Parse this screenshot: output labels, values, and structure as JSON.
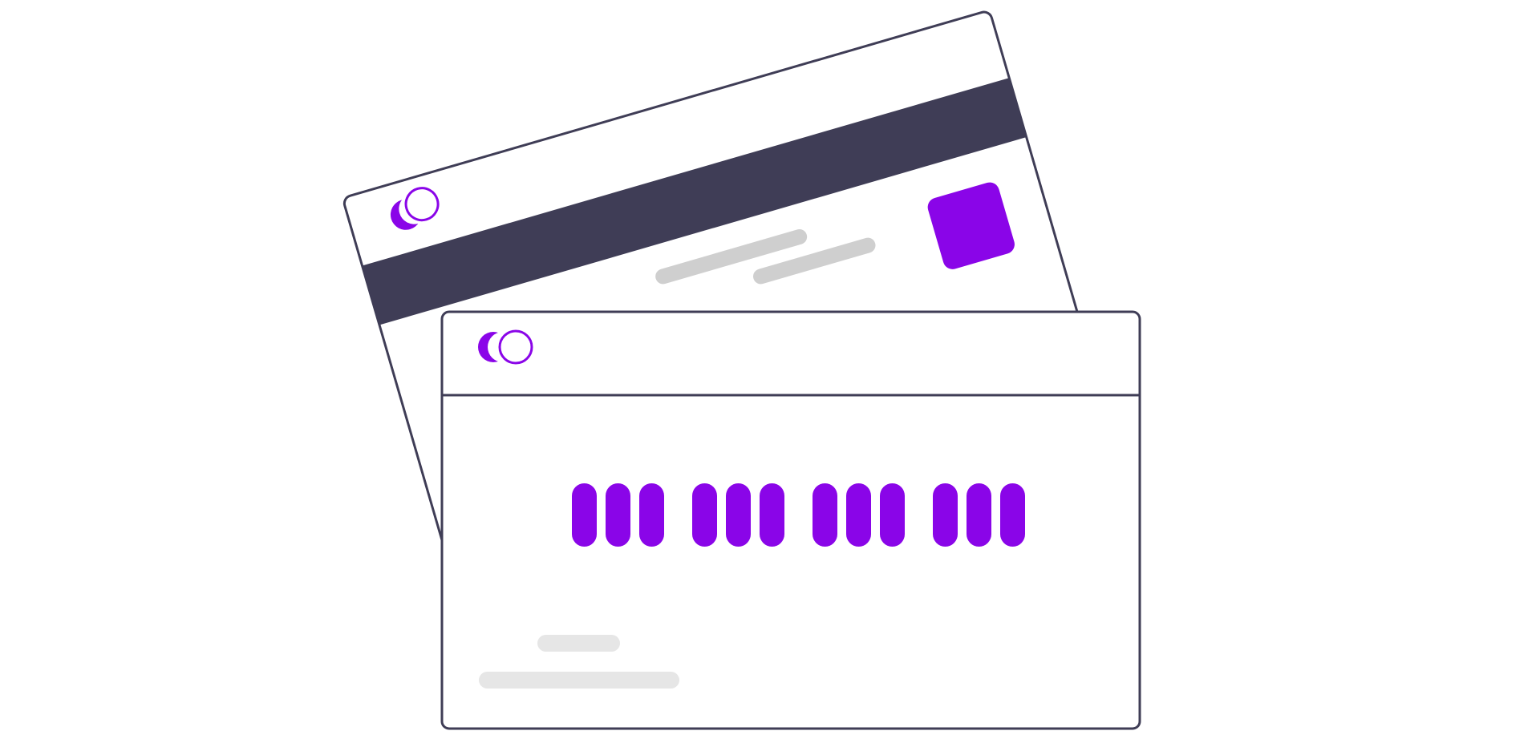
{
  "illustration": {
    "subject": "credit-card-front-and-back",
    "colors": {
      "background": "#ffffff",
      "outline": "#3f3d56",
      "accent": "#8a05e8",
      "placeholder_dark": "#cfcfcf",
      "placeholder_light": "#e6e6e6",
      "card_fill": "#ffffff"
    },
    "front_card": {
      "logo_icon": "two-circles-logo-icon",
      "number_groups": 4,
      "digits_per_group": 3
    },
    "back_card": {
      "logo_icon": "two-circles-logo-icon",
      "magnetic_stripe": true,
      "signature_lines": 2,
      "chip_icon": "square-chip-icon"
    }
  }
}
